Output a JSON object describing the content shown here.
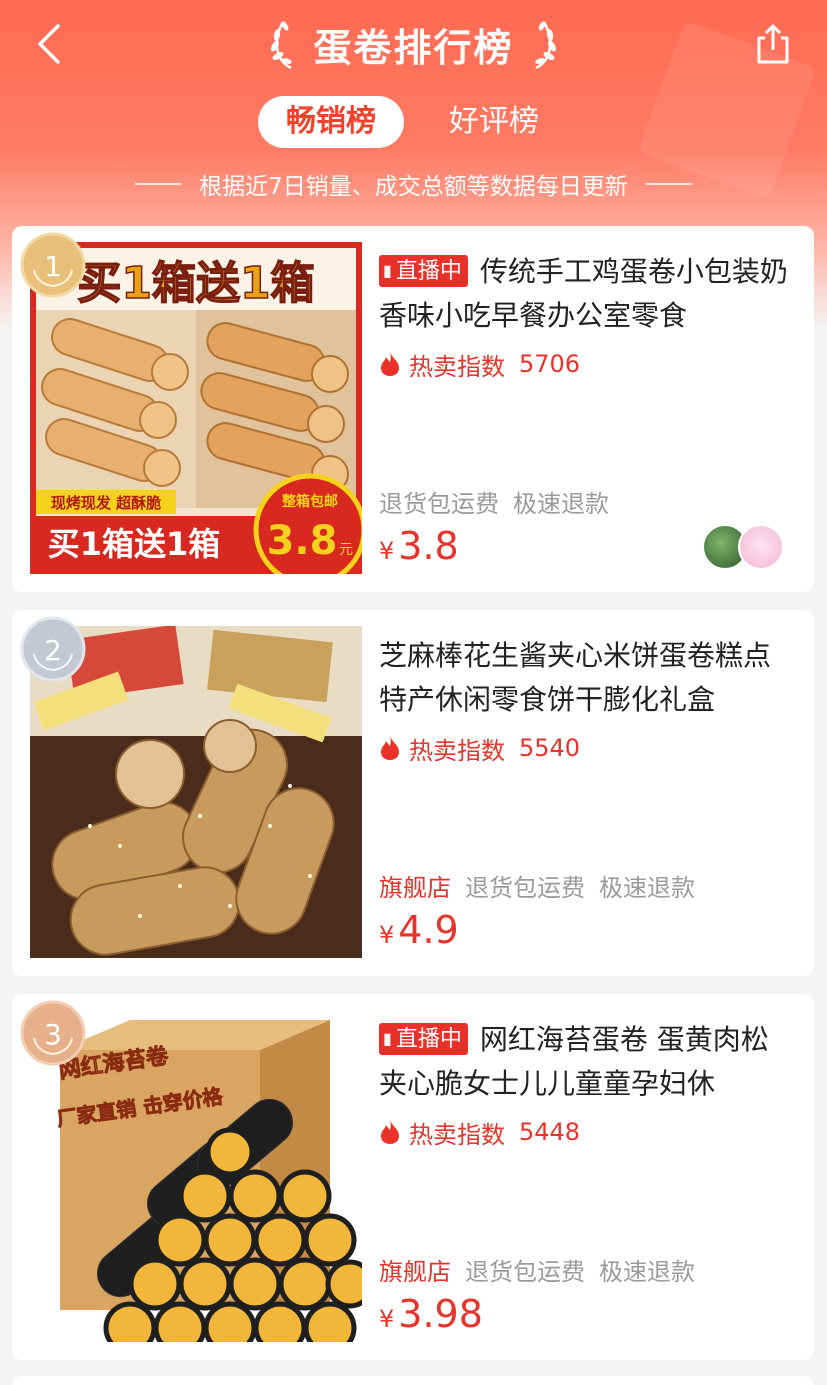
{
  "header": {
    "title": "蛋卷排行榜",
    "tabs": [
      {
        "label": "畅销榜",
        "active": true
      },
      {
        "label": "好评榜",
        "active": false
      }
    ],
    "subtitle": "根据近7日销量、成交总额等数据每日更新"
  },
  "icons": {
    "back": "chevron-left-icon",
    "share": "share-icon",
    "hot": "flame-icon"
  },
  "colors": {
    "header": "#ff6a52",
    "accent_red": "#e8332a",
    "gray_text": "#9b9b9b"
  },
  "products": [
    {
      "rank": "1",
      "live_tag": "直播中",
      "title": "传统手工鸡蛋卷小包装奶香味小吃早餐办公室零食",
      "hot_label": "热卖指数",
      "hot_value": "5706",
      "store_tag": "",
      "tags": [
        "退货包运费",
        "极速退款"
      ],
      "price_symbol": "¥",
      "price": "3.8",
      "image_text": {
        "top_banner": "买1箱送1箱",
        "small_tag": "现烤现发 超酥脆",
        "bottom_banner": "买1箱送1箱",
        "price_circle_label": "整箱包邮",
        "price_circle_value": "3.8",
        "price_circle_unit": "元"
      }
    },
    {
      "rank": "2",
      "live_tag": "",
      "title": "芝麻棒花生酱夹心米饼蛋卷糕点特产休闲零食饼干膨化礼盒",
      "hot_label": "热卖指数",
      "hot_value": "5540",
      "store_tag": "旗舰店",
      "tags": [
        "退货包运费",
        "极速退款"
      ],
      "price_symbol": "¥",
      "price": "4.9"
    },
    {
      "rank": "3",
      "live_tag": "直播中",
      "title": "网红海苔蛋卷 蛋黄肉松夹心脆女士儿儿童童孕妇休",
      "hot_label": "热卖指数",
      "hot_value": "5448",
      "store_tag": "旗舰店",
      "tags": [
        "退货包运费",
        "极速退款"
      ],
      "price_symbol": "¥",
      "price": "3.98",
      "image_text": {
        "box_title": "网红海苔卷",
        "box_slogan": "厂家直销 击穿价格"
      }
    }
  ]
}
